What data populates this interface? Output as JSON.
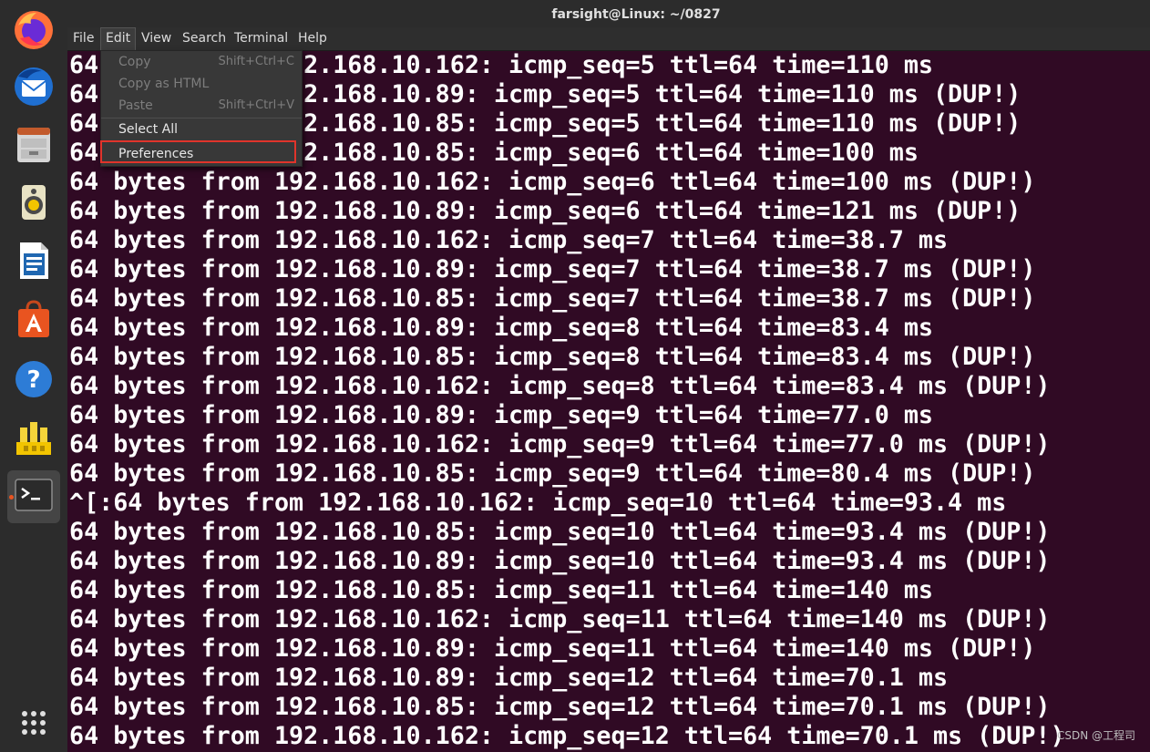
{
  "window": {
    "title": "farsight@Linux: ~/0827"
  },
  "menubar": [
    "File",
    "Edit",
    "View",
    "Search",
    "Terminal",
    "Help"
  ],
  "edit_menu": [
    {
      "label": "Copy",
      "shortcut": "Shift+Ctrl+C",
      "enabled": false
    },
    {
      "label": "Copy as HTML",
      "shortcut": "",
      "enabled": false
    },
    {
      "label": "Paste",
      "shortcut": "Shift+Ctrl+V",
      "enabled": false
    },
    {
      "label": "Select All",
      "shortcut": "",
      "enabled": true
    },
    {
      "label": "Preferences",
      "shortcut": "",
      "enabled": true,
      "highlighted": true
    }
  ],
  "dock": [
    {
      "name": "firefox-icon"
    },
    {
      "name": "thunderbird-icon"
    },
    {
      "name": "files-icon"
    },
    {
      "name": "rhythmbox-icon"
    },
    {
      "name": "libreoffice-writer-icon"
    },
    {
      "name": "ubuntu-software-icon"
    },
    {
      "name": "help-icon"
    },
    {
      "name": "app-icon"
    },
    {
      "name": "terminal-icon",
      "active": true
    },
    {
      "name": "show-applications-icon"
    }
  ],
  "terminal": {
    "lines": [
      "64 bytes from 192.168.10.162: icmp_seq=5 ttl=64 time=110 ms",
      "64 bytes from 192.168.10.89: icmp_seq=5 ttl=64 time=110 ms (DUP!)",
      "64 bytes from 192.168.10.85: icmp_seq=5 ttl=64 time=110 ms (DUP!)",
      "64 bytes from 192.168.10.85: icmp_seq=6 ttl=64 time=100 ms",
      "64 bytes from 192.168.10.162: icmp_seq=6 ttl=64 time=100 ms (DUP!)",
      "64 bytes from 192.168.10.89: icmp_seq=6 ttl=64 time=121 ms (DUP!)",
      "64 bytes from 192.168.10.162: icmp_seq=7 ttl=64 time=38.7 ms",
      "64 bytes from 192.168.10.89: icmp_seq=7 ttl=64 time=38.7 ms (DUP!)",
      "64 bytes from 192.168.10.85: icmp_seq=7 ttl=64 time=38.7 ms (DUP!)",
      "64 bytes from 192.168.10.89: icmp_seq=8 ttl=64 time=83.4 ms",
      "64 bytes from 192.168.10.85: icmp_seq=8 ttl=64 time=83.4 ms (DUP!)",
      "64 bytes from 192.168.10.162: icmp_seq=8 ttl=64 time=83.4 ms (DUP!)",
      "64 bytes from 192.168.10.89: icmp_seq=9 ttl=64 time=77.0 ms",
      "64 bytes from 192.168.10.162: icmp_seq=9 ttl=64 time=77.0 ms (DUP!)",
      "64 bytes from 192.168.10.85: icmp_seq=9 ttl=64 time=80.4 ms (DUP!)",
      "^[:64 bytes from 192.168.10.162: icmp_seq=10 ttl=64 time=93.4 ms",
      "64 bytes from 192.168.10.85: icmp_seq=10 ttl=64 time=93.4 ms (DUP!)",
      "64 bytes from 192.168.10.89: icmp_seq=10 ttl=64 time=93.4 ms (DUP!)",
      "64 bytes from 192.168.10.85: icmp_seq=11 ttl=64 time=140 ms",
      "64 bytes from 192.168.10.162: icmp_seq=11 ttl=64 time=140 ms (DUP!)",
      "64 bytes from 192.168.10.89: icmp_seq=11 ttl=64 time=140 ms (DUP!)",
      "64 bytes from 192.168.10.89: icmp_seq=12 ttl=64 time=70.1 ms",
      "64 bytes from 192.168.10.85: icmp_seq=12 ttl=64 time=70.1 ms (DUP!)",
      "64 bytes from 192.168.10.162: icmp_seq=12 ttl=64 time=70.1 ms (DUP!)"
    ]
  },
  "watermark": "CSDN @工程司",
  "colors": {
    "terminal_bg": "#300a24",
    "terminal_fg": "#ffffff",
    "highlight_border": "#e0342b",
    "accent": "#e95420"
  }
}
